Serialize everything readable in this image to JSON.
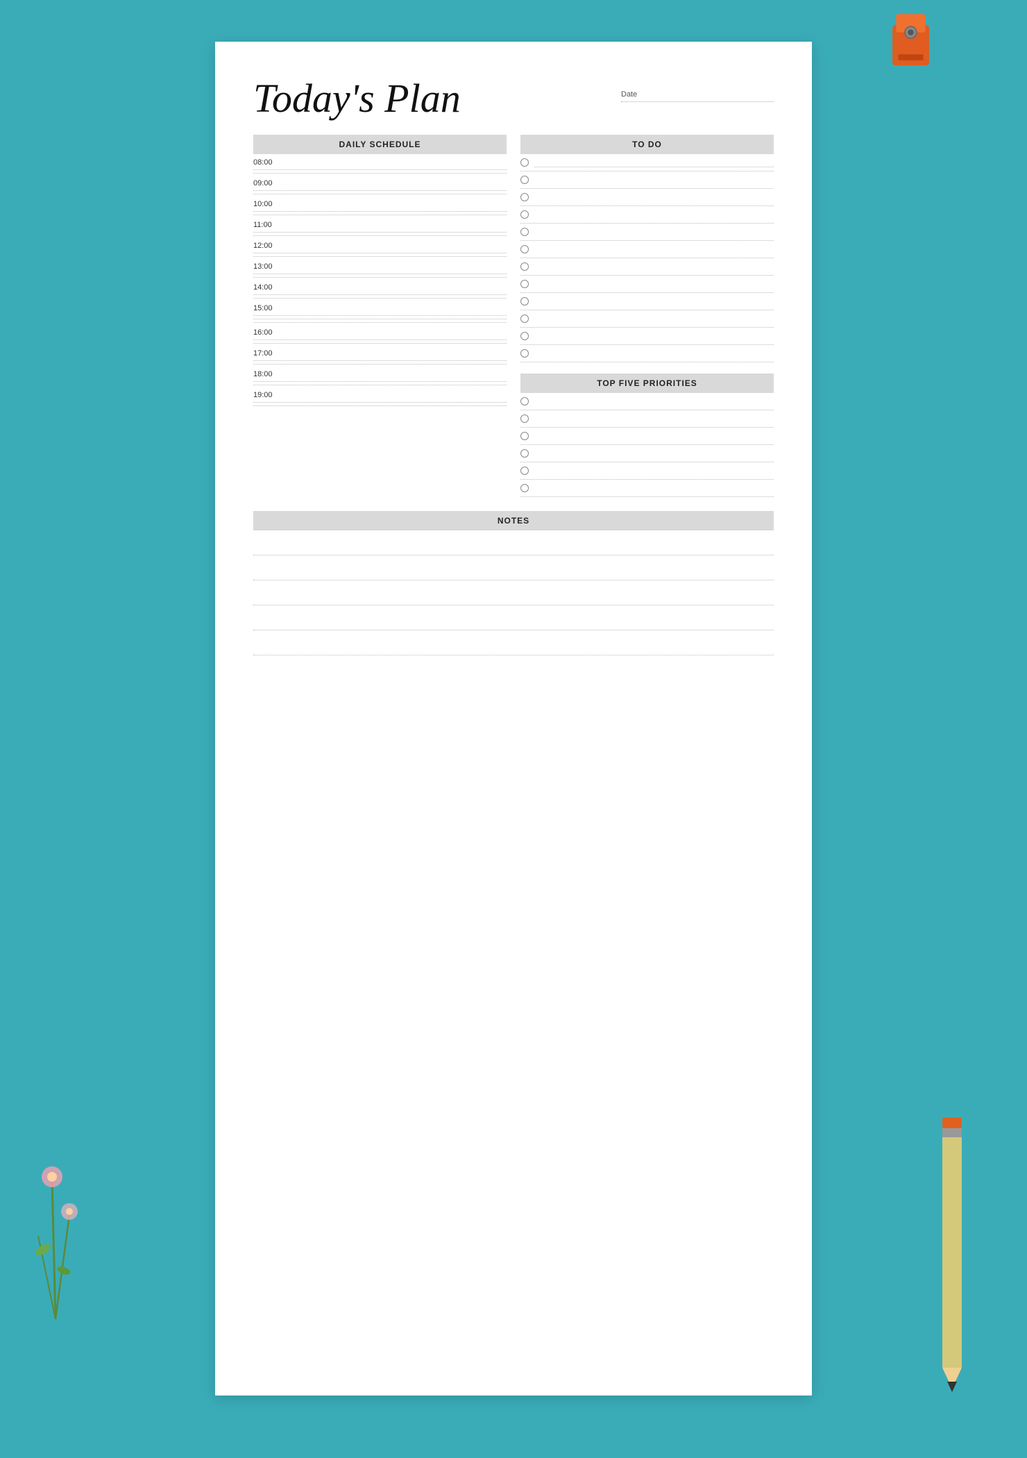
{
  "page": {
    "title": "Today's Plan",
    "date_label": "Date",
    "daily_schedule_label": "DAILY SCHEDULE",
    "todo_label": "TO DO",
    "top_priorities_label": "TOP FIVE PRIORITIES",
    "notes_label": "NOTES",
    "hours": [
      "08:00",
      "09:00",
      "10:00",
      "11:00",
      "12:00",
      "13:00",
      "14:00",
      "15:00",
      "16:00",
      "17:00",
      "18:00",
      "19:00"
    ],
    "todo_items": 12,
    "priority_items": 6,
    "note_lines": 5,
    "colors": {
      "background": "#3aacb8",
      "paper": "#ffffff",
      "header_bg": "#d9d9d9",
      "dotted_line": "#bbbbbb",
      "text_dark": "#222222",
      "text_muted": "#555555"
    }
  }
}
